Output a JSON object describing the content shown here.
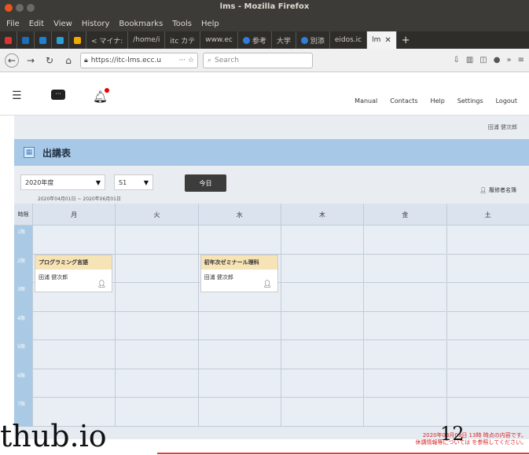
{
  "window": {
    "title": "lms - Mozilla Firefox"
  },
  "menu": [
    "File",
    "Edit",
    "View",
    "History",
    "Bookmarks",
    "Tools",
    "Help"
  ],
  "tabs": [
    {
      "label": "",
      "color": "#d33"
    },
    {
      "label": "",
      "color": "#1c6fb5"
    },
    {
      "label": "",
      "color": "#1d7fd1"
    },
    {
      "label": "",
      "color": "#2a9fd6"
    },
    {
      "label": "",
      "color": "#f2a900"
    },
    {
      "label": "< マイナ:",
      "color": "#888"
    },
    {
      "label": "/home/i",
      "color": "#888"
    },
    {
      "label": "itc カテ",
      "color": "#444"
    },
    {
      "label": "www.ec",
      "color": "#888"
    },
    {
      "label": "参考",
      "color": "#2f7fd9"
    },
    {
      "label": "大学",
      "color": "#888"
    },
    {
      "label": "別添",
      "color": "#2f7fd9"
    },
    {
      "label": "eidos.ic",
      "color": "#888"
    },
    {
      "label": "lm",
      "color": "#8ab"
    }
  ],
  "nav": {
    "url": "https://itc-lms.ecc.u",
    "search_placeholder": "Search"
  },
  "lms": {
    "links": [
      "Manual",
      "Contacts",
      "Help",
      "Settings",
      "Logout"
    ],
    "user": "田浦 健次郎",
    "page_title": "出講表",
    "year": "2020年度",
    "term": "S1",
    "period": "2020年04月01日 ~ 2020年06月01日",
    "today": "今日",
    "roster": "履修者名簿"
  },
  "timetable": {
    "corner": "時限",
    "days": [
      "月",
      "火",
      "水",
      "木",
      "金",
      "土"
    ],
    "periods": [
      "1限",
      "2限",
      "3限",
      "4限",
      "5限",
      "6限",
      "7限"
    ],
    "courses": [
      {
        "day": 0,
        "period": 1,
        "name": "プログラミング言語",
        "teacher": "田浦 健次郎"
      },
      {
        "day": 2,
        "period": 1,
        "name": "初年次ゼミナール理科",
        "teacher": "田浦 健次郎"
      }
    ]
  },
  "footer": {
    "line1": "2020年03月09日 13時 時点の内容です。",
    "line2": "休講情報等については を参照してください。"
  },
  "overlay": "thub.io",
  "page_number": "12"
}
